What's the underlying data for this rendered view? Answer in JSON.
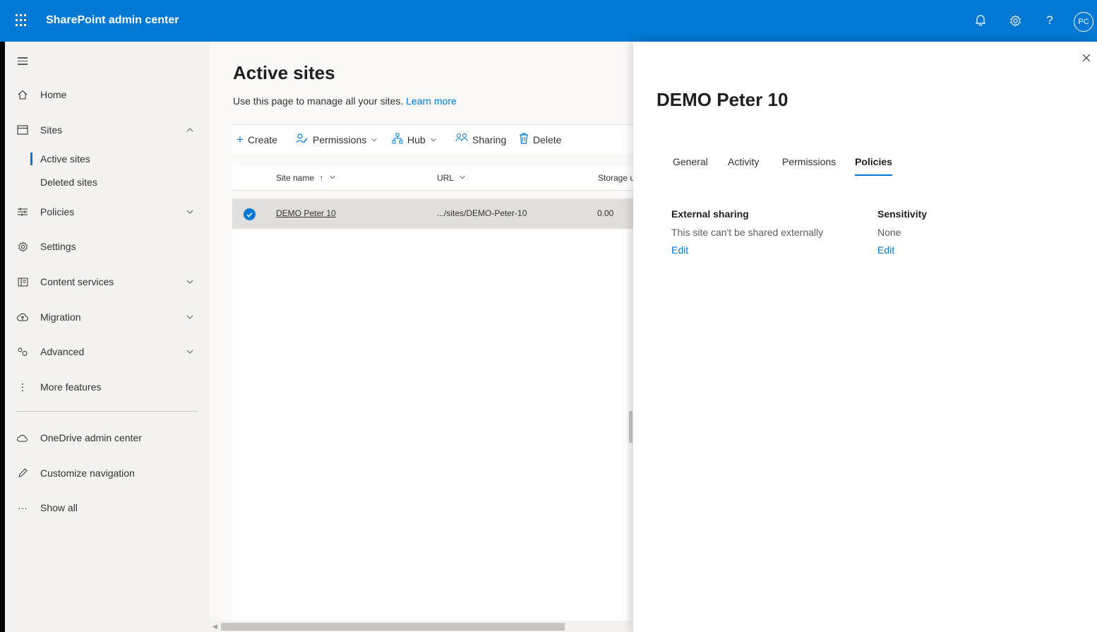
{
  "header": {
    "app_title": "SharePoint admin center",
    "avatar_initials": "PC",
    "icons": [
      "waffle-icon",
      "bell-icon",
      "gear-icon",
      "help-icon"
    ]
  },
  "nav": {
    "items": [
      {
        "label": "Home",
        "icon": "home-icon"
      },
      {
        "label": "Sites",
        "icon": "sites-icon",
        "expanded": true
      },
      {
        "label": "Policies",
        "icon": "policies-icon"
      },
      {
        "label": "Settings",
        "icon": "settings-icon"
      },
      {
        "label": "Content services",
        "icon": "content-services-icon"
      },
      {
        "label": "Migration",
        "icon": "migration-icon"
      },
      {
        "label": "Advanced",
        "icon": "advanced-icon"
      },
      {
        "label": "More features",
        "icon": "more-features-icon"
      },
      {
        "label": "OneDrive admin center",
        "icon": "onedrive-icon"
      },
      {
        "label": "Customize navigation",
        "icon": "pencil-icon"
      },
      {
        "label": "Show all",
        "icon": "ellipsis-icon"
      }
    ],
    "sub_items": [
      {
        "label": "Active sites",
        "active": true
      },
      {
        "label": "Deleted sites",
        "active": false
      }
    ]
  },
  "main": {
    "title": "Active sites",
    "description": "Use this page to manage all your sites.",
    "learn_more": "Learn more",
    "commands": [
      {
        "label": "Create"
      },
      {
        "label": "Permissions"
      },
      {
        "label": "Hub"
      },
      {
        "label": "Sharing"
      },
      {
        "label": "Delete"
      }
    ],
    "columns": [
      {
        "label": "Site name",
        "sort": "↑"
      },
      {
        "label": "URL"
      },
      {
        "label": "Storage u"
      }
    ],
    "rows": [
      {
        "site_name": "DEMO Peter 10",
        "url": ".../sites/DEMO-Peter-10",
        "storage": "0.00",
        "selected": true
      }
    ]
  },
  "panel": {
    "title": "DEMO Peter 10",
    "tabs": [
      {
        "label": "General"
      },
      {
        "label": "Activity"
      },
      {
        "label": "Permissions"
      },
      {
        "label": "Policies",
        "active": true
      }
    ],
    "external_sharing": {
      "label": "External sharing",
      "value": "This site can't be shared externally",
      "edit": "Edit"
    },
    "sensitivity": {
      "label": "Sensitivity",
      "value": "None",
      "edit": "Edit"
    }
  },
  "colors": {
    "brand": "#0078d4",
    "nav_bg": "#f3f2f1",
    "selected_row": "#e1dfdd"
  }
}
